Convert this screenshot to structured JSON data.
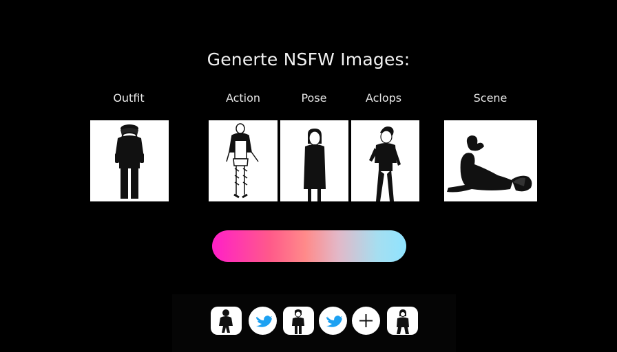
{
  "header": {
    "title": "Generte NSFW Images:"
  },
  "categories": [
    {
      "label": "Outfit"
    },
    {
      "label": "Action"
    },
    {
      "label": "Pose"
    },
    {
      "label": "Aclops"
    },
    {
      "label": "Scene"
    }
  ],
  "tiles": [
    {
      "icon": "outfit-figure-image"
    },
    {
      "icon": "action-figure-image"
    },
    {
      "icon": "pose-figure-image"
    },
    {
      "icon": "aclops-figure-image"
    },
    {
      "icon": "scene-figure-image"
    }
  ],
  "generate_bar": {
    "gradient_colors": [
      "#ff1fc8",
      "#ff5a8a",
      "#ff8a8a",
      "#e2b8c8",
      "#a6def0",
      "#8fe4ff"
    ]
  },
  "dock": {
    "buttons": [
      {
        "icon": "figure-thumbnail-icon"
      },
      {
        "icon": "twitter-bird-icon",
        "color": "#1da1f2"
      },
      {
        "icon": "figure-thumbnail-icon"
      },
      {
        "icon": "twitter-bird-icon",
        "color": "#1da1f2"
      },
      {
        "icon": "plus-icon",
        "glyph": "+"
      },
      {
        "icon": "figure-thumbnail-icon"
      }
    ]
  }
}
